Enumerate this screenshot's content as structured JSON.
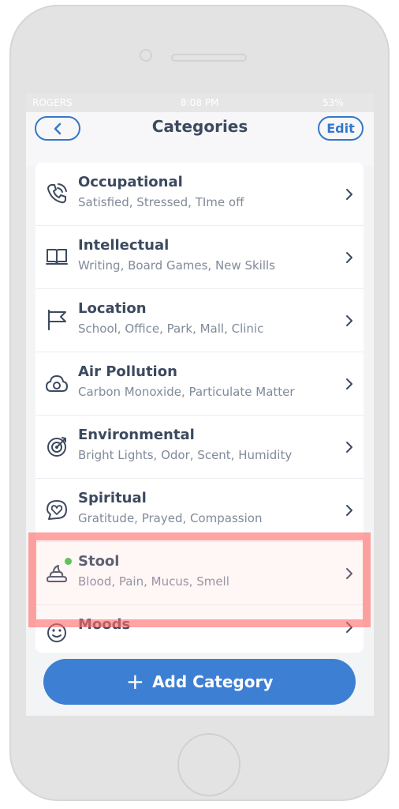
{
  "status_bar": {
    "carrier": "ROGERS",
    "time": "8:08 PM",
    "battery": "53%"
  },
  "nav": {
    "title": "Categories",
    "edit_label": "Edit"
  },
  "categories": [
    {
      "title": "Occupational",
      "subtitle": "Satisfied, Stressed, TIme off",
      "icon": "phone-icon"
    },
    {
      "title": "Intellectual",
      "subtitle": "Writing, Board Games, New Skills",
      "icon": "book-icon"
    },
    {
      "title": "Location",
      "subtitle": "School, Office, Park, Mall, Clinic",
      "icon": "flag-icon"
    },
    {
      "title": "Air Pollution",
      "subtitle": "Carbon Monoxide, Particulate Matter",
      "icon": "cloud-icon"
    },
    {
      "title": "Environmental",
      "subtitle": "Bright Lights, Odor, Scent, Humidity",
      "icon": "target-icon"
    },
    {
      "title": "Spiritual",
      "subtitle": "Gratitude, Prayed, Compassion",
      "icon": "heart-bubble-icon"
    },
    {
      "title": "Stool",
      "subtitle": "Blood, Pain, Mucus, Smell",
      "icon": "stool-icon",
      "status": "new"
    },
    {
      "title": "Moods",
      "subtitle": "",
      "icon": "smiley-icon"
    }
  ],
  "add_button": {
    "label": "Add Category"
  },
  "colors": {
    "accent": "#3d7fd3",
    "title_text": "#3c4a5f",
    "highlight": "#ff5f5f",
    "new_dot": "#3ec23e"
  }
}
